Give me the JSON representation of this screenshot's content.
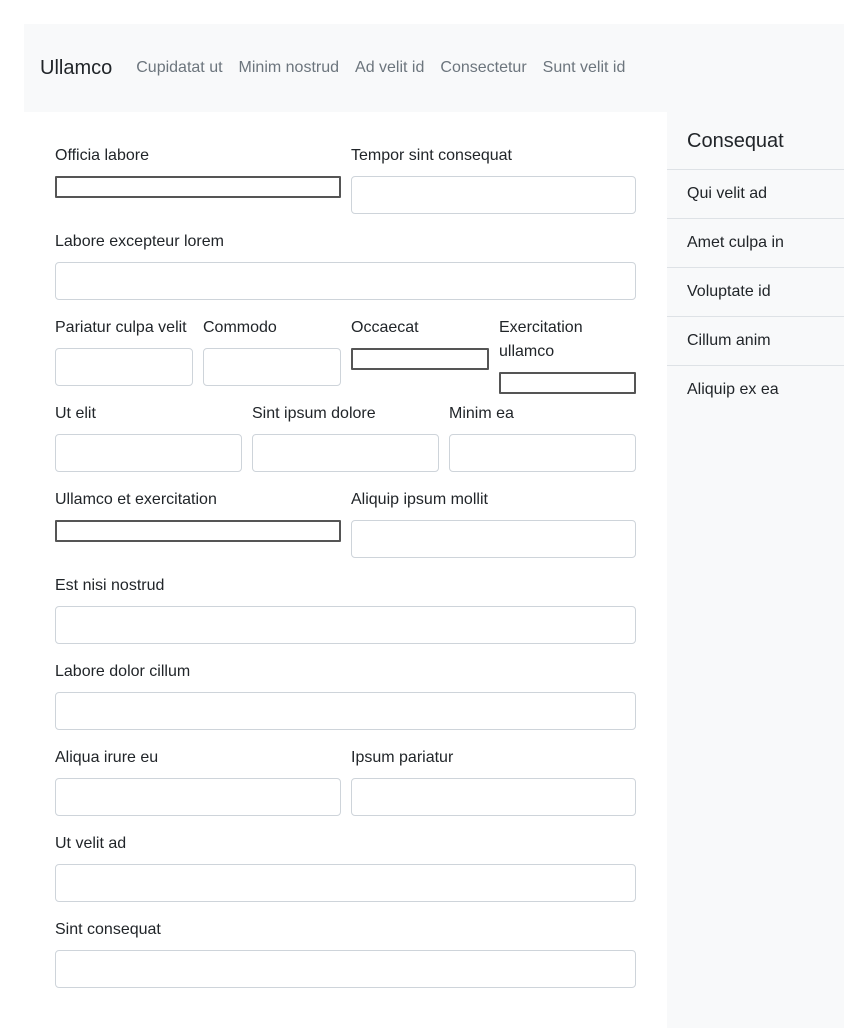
{
  "navbar": {
    "brand": "Ullamco",
    "links": [
      "Cupidatat ut",
      "Minim nostrud",
      "Ad velit id",
      "Consectetur",
      "Sunt velit id"
    ]
  },
  "form": {
    "officia_labore": "Officia labore",
    "tempor_sint_consequat": "Tempor sint consequat",
    "labore_excepteur_lorem": "Labore excepteur lorem",
    "pariatur_culpa_velit": "Pariatur culpa velit",
    "commodo": "Commodo",
    "occaecat": "Occaecat",
    "exercitation_ullamco": "Exercitation ullamco",
    "ut_elit": "Ut elit",
    "sint_ipsum_dolore": "Sint ipsum dolore",
    "minim_ea": "Minim ea",
    "ullamco_et_exercitation": "Ullamco et exercitation",
    "aliquip_ipsum_mollit": "Aliquip ipsum mollit",
    "est_nisi_nostrud": "Est nisi nostrud",
    "labore_dolor_cillum": "Labore dolor cillum",
    "aliqua_irure_eu": "Aliqua irure eu",
    "ipsum_pariatur": "Ipsum pariatur",
    "ut_velit_ad": "Ut velit ad",
    "sint_consequat": "Sint consequat"
  },
  "sidebar": {
    "heading": "Consequat",
    "items": [
      "Qui velit ad",
      "Amet culpa in",
      "Voluptate id",
      "Cillum anim",
      "Aliquip ex ea"
    ]
  }
}
